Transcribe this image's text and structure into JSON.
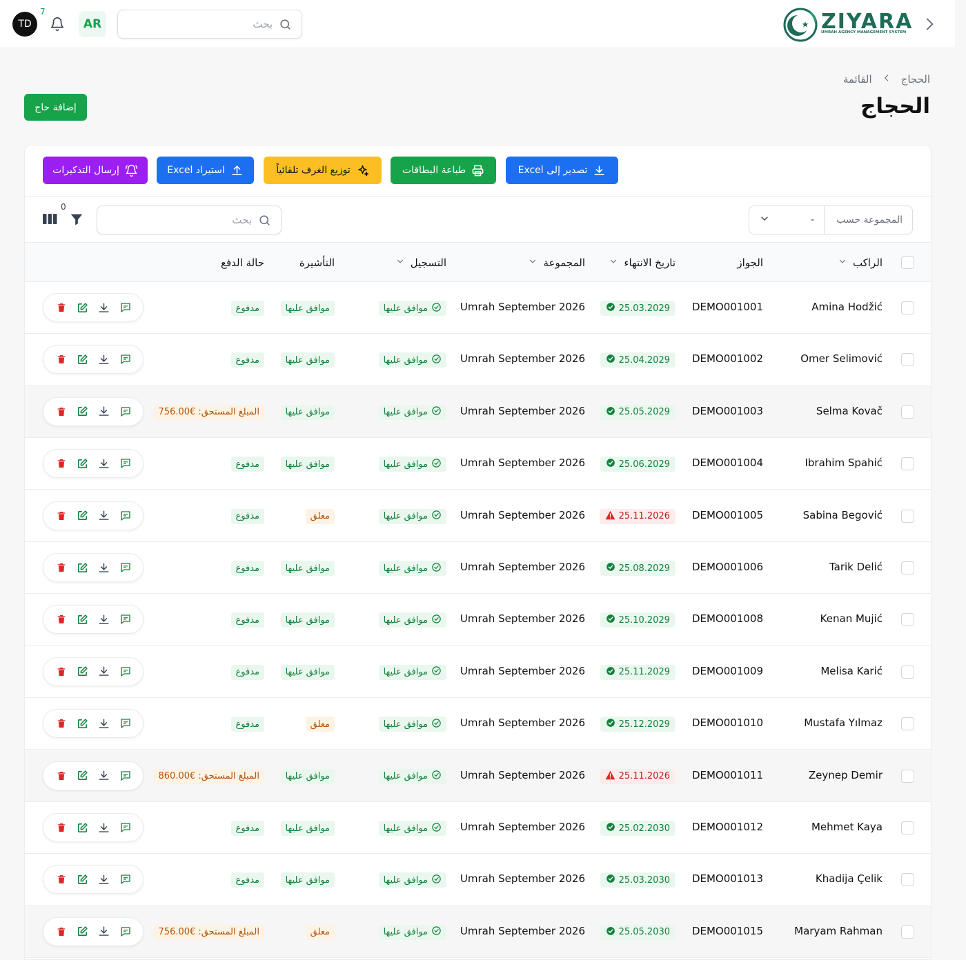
{
  "topbar": {
    "avatar_initials": "TD",
    "notifications_count": "7",
    "language": "AR",
    "search_placeholder": "بحث",
    "logo_title": "ZIYARA",
    "logo_subtitle": "UMRAH AGENCY MANAGEMENT SYSTEM"
  },
  "header": {
    "breadcrumb": [
      "الحجاج",
      "القائمة"
    ],
    "title": "الحجاج",
    "add_button": "إضافة حاج"
  },
  "actions": {
    "export_excel": "تصدير إلى Excel",
    "print_cards": "طباعة البطاقات",
    "auto_rooms": "توزيع الغرف تلقائياً",
    "import_excel": "استيراد Excel",
    "send_reminders": "إرسال التذكيرات"
  },
  "filters": {
    "group_by_label": "المجموعة حسب",
    "group_by_value": "-",
    "search_placeholder": "بحث",
    "active_filters": "0"
  },
  "columns": {
    "passenger": "الراكب",
    "passport": "الجواز",
    "expiry": "تاريخ الانتهاء",
    "group": "المجموعة",
    "registration": "التسجيل",
    "visa": "التأشيرة",
    "payment": "حالة الدفع"
  },
  "colors": {
    "primary_green": "#16a34a",
    "blue": "#1d6ff2",
    "amber": "#fbbf24",
    "purple": "#9b1ff0",
    "danger": "#dc2626"
  },
  "rows": [
    {
      "name": "Amina Hodžić",
      "passport": "DEMO001001",
      "expiry": "25.03.2029",
      "expiry_status": "ok",
      "group": "Umrah September 2026",
      "registration": "موافق عليها",
      "visa": "موافق عليها",
      "visa_status": "approved",
      "payment": "مدفوع",
      "payment_status": "paid"
    },
    {
      "name": "Omer Selimović",
      "passport": "DEMO001002",
      "expiry": "25.04.2029",
      "expiry_status": "ok",
      "group": "Umrah September 2026",
      "registration": "موافق عليها",
      "visa": "موافق عليها",
      "visa_status": "approved",
      "payment": "مدفوع",
      "payment_status": "paid"
    },
    {
      "name": "Selma Kovač",
      "passport": "DEMO001003",
      "expiry": "25.05.2029",
      "expiry_status": "ok",
      "group": "Umrah September 2026",
      "registration": "موافق عليها",
      "visa": "موافق عليها",
      "visa_status": "approved",
      "payment": "المبلغ المستحق: €756.00",
      "payment_status": "due"
    },
    {
      "name": "Ibrahim Spahić",
      "passport": "DEMO001004",
      "expiry": "25.06.2029",
      "expiry_status": "ok",
      "group": "Umrah September 2026",
      "registration": "موافق عليها",
      "visa": "موافق عليها",
      "visa_status": "approved",
      "payment": "مدفوع",
      "payment_status": "paid"
    },
    {
      "name": "Sabina Begović",
      "passport": "DEMO001005",
      "expiry": "25.11.2026",
      "expiry_status": "bad",
      "group": "Umrah September 2026",
      "registration": "موافق عليها",
      "visa": "معلق",
      "visa_status": "pending",
      "payment": "مدفوع",
      "payment_status": "paid"
    },
    {
      "name": "Tarik Delić",
      "passport": "DEMO001006",
      "expiry": "25.08.2029",
      "expiry_status": "ok",
      "group": "Umrah September 2026",
      "registration": "موافق عليها",
      "visa": "موافق عليها",
      "visa_status": "approved",
      "payment": "مدفوع",
      "payment_status": "paid"
    },
    {
      "name": "Kenan Mujić",
      "passport": "DEMO001008",
      "expiry": "25.10.2029",
      "expiry_status": "ok",
      "group": "Umrah September 2026",
      "registration": "موافق عليها",
      "visa": "موافق عليها",
      "visa_status": "approved",
      "payment": "مدفوع",
      "payment_status": "paid"
    },
    {
      "name": "Melisa Karić",
      "passport": "DEMO001009",
      "expiry": "25.11.2029",
      "expiry_status": "ok",
      "group": "Umrah September 2026",
      "registration": "موافق عليها",
      "visa": "موافق عليها",
      "visa_status": "approved",
      "payment": "مدفوع",
      "payment_status": "paid"
    },
    {
      "name": "Mustafa Yılmaz",
      "passport": "DEMO001010",
      "expiry": "25.12.2029",
      "expiry_status": "ok",
      "group": "Umrah September 2026",
      "registration": "موافق عليها",
      "visa": "معلق",
      "visa_status": "pending",
      "payment": "مدفوع",
      "payment_status": "paid"
    },
    {
      "name": "Zeynep Demir",
      "passport": "DEMO001011",
      "expiry": "25.11.2026",
      "expiry_status": "bad",
      "group": "Umrah September 2026",
      "registration": "موافق عليها",
      "visa": "موافق عليها",
      "visa_status": "approved",
      "payment": "المبلغ المستحق: €860.00",
      "payment_status": "due"
    },
    {
      "name": "Mehmet Kaya",
      "passport": "DEMO001012",
      "expiry": "25.02.2030",
      "expiry_status": "ok",
      "group": "Umrah September 2026",
      "registration": "موافق عليها",
      "visa": "موافق عليها",
      "visa_status": "approved",
      "payment": "مدفوع",
      "payment_status": "paid"
    },
    {
      "name": "Khadija Çelik",
      "passport": "DEMO001013",
      "expiry": "25.03.2030",
      "expiry_status": "ok",
      "group": "Umrah September 2026",
      "registration": "موافق عليها",
      "visa": "موافق عليها",
      "visa_status": "approved",
      "payment": "مدفوع",
      "payment_status": "paid"
    },
    {
      "name": "Maryam Rahman",
      "passport": "DEMO001015",
      "expiry": "25.05.2030",
      "expiry_status": "ok",
      "group": "Umrah September 2026",
      "registration": "موافق عليها",
      "visa": "معلق",
      "visa_status": "pending",
      "payment": "المبلغ المستحق: €756.00",
      "payment_status": "due"
    }
  ]
}
